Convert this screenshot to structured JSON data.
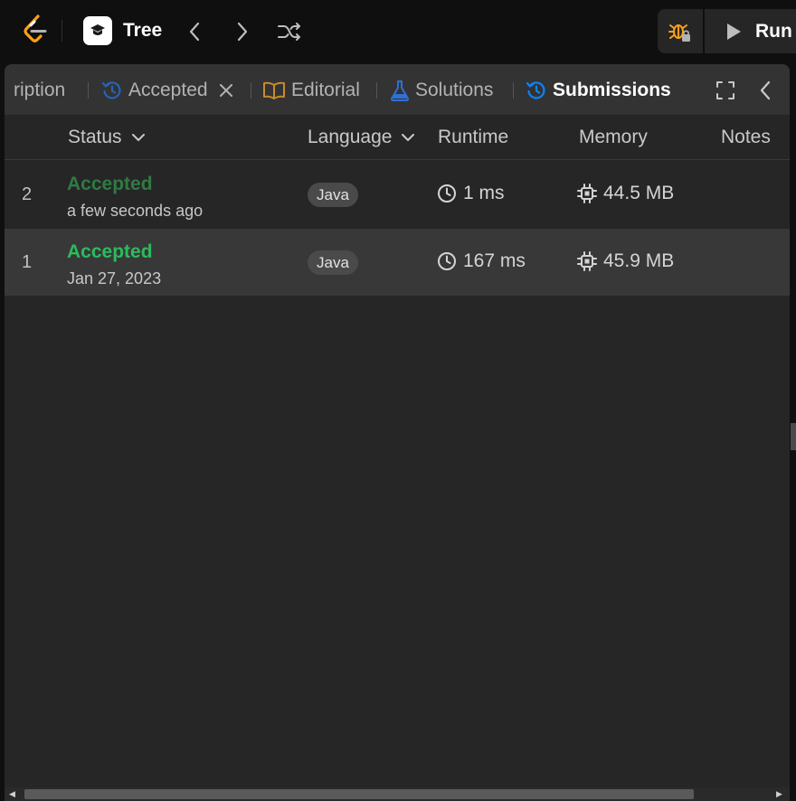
{
  "topbar": {
    "problem_title": "Tree",
    "run_label": "Run",
    "icons": [
      "leetcode-logo",
      "graduation-cap-icon",
      "chevron-left-icon",
      "chevron-right-icon",
      "shuffle-icon",
      "debug-icon",
      "play-icon"
    ]
  },
  "tabs": {
    "description": "ription",
    "accepted": "Accepted",
    "editorial": "Editorial",
    "solutions": "Solutions",
    "submissions": "Submissions"
  },
  "table": {
    "headers": {
      "status": "Status",
      "language": "Language",
      "runtime": "Runtime",
      "memory": "Memory",
      "notes": "Notes"
    },
    "rows": [
      {
        "index": "2",
        "status": "Accepted",
        "time": "a few seconds ago",
        "language": "Java",
        "runtime": "1 ms",
        "memory": "44.5 MB"
      },
      {
        "index": "1",
        "status": "Accepted",
        "time": "Jan 27, 2023",
        "language": "Java",
        "runtime": "167 ms",
        "memory": "45.9 MB"
      }
    ]
  },
  "colors": {
    "accepted_dim": "#2f7a45",
    "accepted": "#2cbb5d",
    "submissions_blue": "#0a84ff",
    "editorial_orange": "#e6a23c",
    "solutions_blue": "#3b82f6",
    "logo_orange": "#ffa116"
  }
}
